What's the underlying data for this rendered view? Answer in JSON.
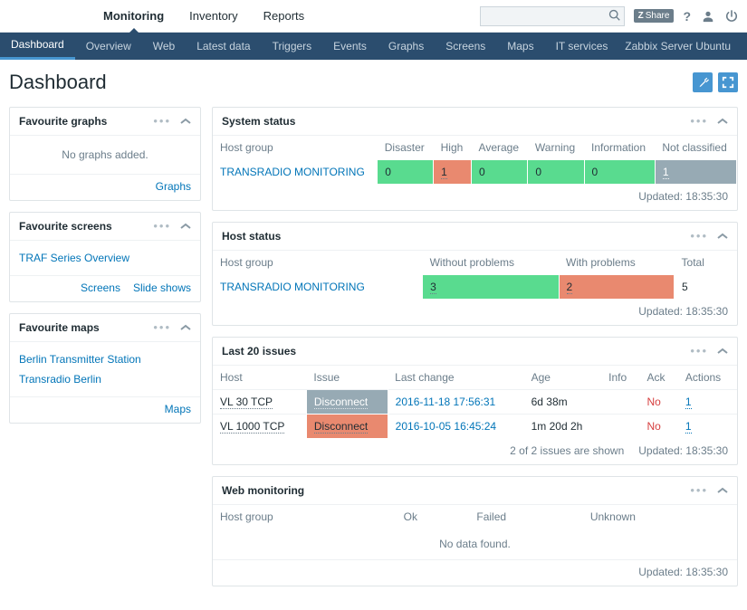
{
  "topMenu": [
    "Monitoring",
    "Inventory",
    "Reports"
  ],
  "topMenuActive": 0,
  "shareLabel": "Share",
  "subMenu": [
    "Dashboard",
    "Overview",
    "Web",
    "Latest data",
    "Triggers",
    "Events",
    "Graphs",
    "Screens",
    "Maps",
    "IT services"
  ],
  "subMenuActive": 0,
  "serverLabel": "Zabbix Server Ubuntu",
  "pageTitle": "Dashboard",
  "favGraphs": {
    "title": "Favourite graphs",
    "empty": "No graphs added.",
    "links": [
      "Graphs"
    ]
  },
  "favScreens": {
    "title": "Favourite screens",
    "items": [
      "TRAF Series Overview"
    ],
    "links": [
      "Screens",
      "Slide shows"
    ]
  },
  "favMaps": {
    "title": "Favourite maps",
    "items": [
      "Berlin Transmitter Station",
      "Transradio Berlin"
    ],
    "links": [
      "Maps"
    ]
  },
  "systemStatus": {
    "title": "System status",
    "cols": [
      "Host group",
      "Disaster",
      "High",
      "Average",
      "Warning",
      "Information",
      "Not classified"
    ],
    "row": {
      "group": "TRANSRADIO MONITORING",
      "vals": [
        {
          "v": "0",
          "cls": "sev-green"
        },
        {
          "v": "1",
          "cls": "sev-orange"
        },
        {
          "v": "0",
          "cls": "sev-green"
        },
        {
          "v": "0",
          "cls": "sev-green"
        },
        {
          "v": "0",
          "cls": "sev-green"
        },
        {
          "v": "1",
          "cls": "sev-grey"
        }
      ]
    },
    "updated": "Updated: 18:35:30"
  },
  "hostStatus": {
    "title": "Host status",
    "cols": [
      "Host group",
      "Without problems",
      "With problems",
      "Total"
    ],
    "row": {
      "group": "TRANSRADIO MONITORING",
      "without": {
        "v": "3",
        "cls": "sev-green"
      },
      "with": {
        "v": "2",
        "cls": "sev-orange"
      },
      "total": "5"
    },
    "updated": "Updated: 18:35:30"
  },
  "lastIssues": {
    "title": "Last 20 issues",
    "cols": [
      "Host",
      "Issue",
      "Last change",
      "Age",
      "Info",
      "Ack",
      "Actions"
    ],
    "rows": [
      {
        "host": "VL 30 TCP",
        "issue": "Disconnect",
        "issueCls": "sev-grey",
        "lastChange": "2016-11-18 17:56:31",
        "age": "6d 38m",
        "info": "",
        "ack": "No",
        "actions": "1"
      },
      {
        "host": "VL 1000 TCP",
        "issue": "Disconnect",
        "issueCls": "sev-orange",
        "lastChange": "2016-10-05 16:45:24",
        "age": "1m 20d 2h",
        "info": "",
        "ack": "No",
        "actions": "1"
      }
    ],
    "shown": "2 of 2 issues are shown",
    "updated": "Updated: 18:35:30"
  },
  "webMon": {
    "title": "Web monitoring",
    "cols": [
      "Host group",
      "Ok",
      "Failed",
      "Unknown"
    ],
    "empty": "No data found.",
    "updated": "Updated: 18:35:30"
  }
}
